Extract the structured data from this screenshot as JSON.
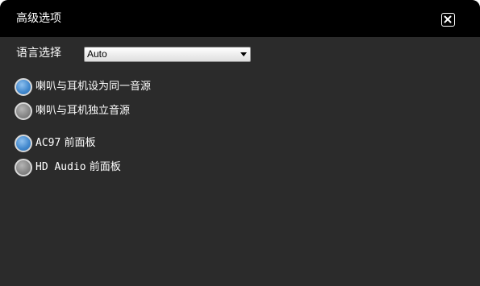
{
  "window": {
    "title": "高级选项",
    "close_icon": "close-icon"
  },
  "language": {
    "label": "语言选择",
    "selected": "Auto"
  },
  "output_mode": [
    {
      "label": "喇叭与耳机设为同一音源",
      "selected": true
    },
    {
      "label": "喇叭与耳机独立音源",
      "selected": false
    }
  ],
  "front_panel": [
    {
      "prefix": "AC97",
      "suffix": "前面板",
      "selected": true
    },
    {
      "prefix": "HD Audio",
      "suffix": "前面板",
      "selected": false
    }
  ],
  "colors": {
    "title_bar": "#000000",
    "panel_bg": "#2b2b2b",
    "radio_selected": "#3f86cc",
    "radio_unselected": "#858585"
  }
}
